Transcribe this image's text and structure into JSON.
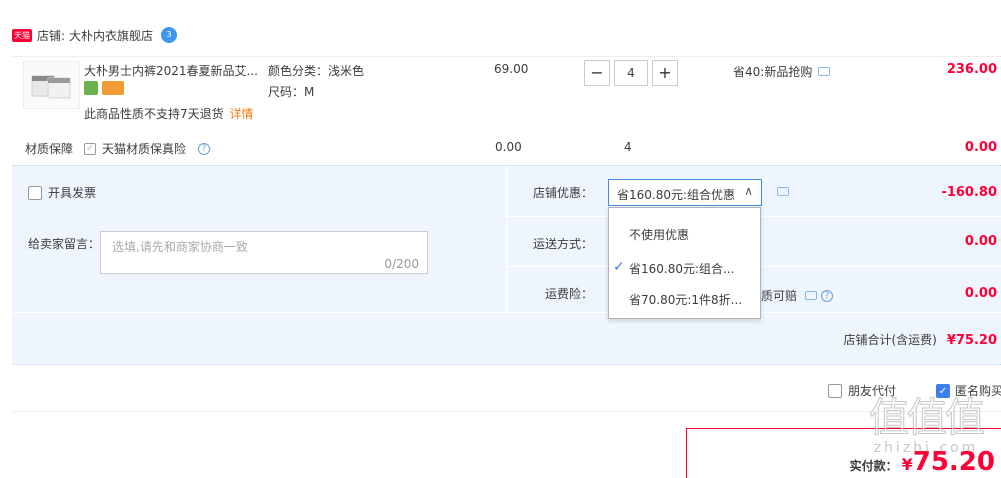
{
  "shop": {
    "badge": "天猫",
    "label": "店铺:",
    "name": "大朴内衣旗舰店",
    "wangwang": "3"
  },
  "item": {
    "title": "大朴男士内裤2021春夏新品艾...",
    "color_label": "颜色分类：浅米色",
    "size_label": "尺码：M",
    "notice": "此商品性质不支持7天退货",
    "detail_link": "详情",
    "price": "69.00",
    "quantity": "4",
    "minus": "−",
    "plus": "+",
    "promo": "省40:新品抢购",
    "total": "236.00"
  },
  "insurance": {
    "label": "材质保障",
    "option": "天猫材质保真险",
    "price": "0.00",
    "quantity": "4",
    "total": "0.00"
  },
  "invoice": {
    "label": "开具发票"
  },
  "message": {
    "label": "给卖家留言：",
    "placeholder": "选填,请先和商家协商一致",
    "counter": "0/200"
  },
  "discount": {
    "label": "店铺优惠：",
    "selected": "省160.80元:组合优惠",
    "amount": "-160.80",
    "options": [
      "不使用优惠",
      "省160.80元:组合...",
      "省70.80元:1件8折..."
    ]
  },
  "shipping": {
    "label": "运送方式：",
    "amount": "0.00"
  },
  "shipping_insurance": {
    "label": "运费险：",
    "partial": "质可赔",
    "amount": "0.00"
  },
  "shop_total": {
    "label": "店铺合计(含运费)",
    "amount": "¥75.20"
  },
  "friend_pay": {
    "label": "朋友代付"
  },
  "anonymous": {
    "label": "匿名购买"
  },
  "payable": {
    "label": "实付款：",
    "currency": "¥",
    "amount": "75.20"
  },
  "watermark": {
    "text": "值值值",
    "sub": "zhizhi.com"
  },
  "colors": {
    "accent": "#ff0036",
    "link": "#3d7fe8",
    "panel": "#eef5fd"
  }
}
